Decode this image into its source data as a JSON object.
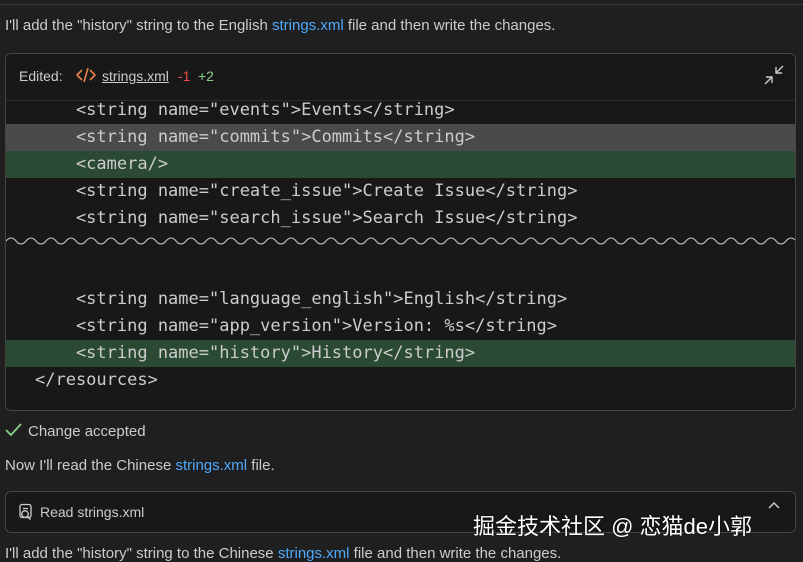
{
  "message_1": {
    "before": "I'll add the \"history\" string to the English ",
    "file": "strings.xml",
    "after": " file and then write the changes."
  },
  "edit_card": {
    "label": "Edited:",
    "file": "strings.xml",
    "removed": "-1",
    "added": "+2",
    "icon": "code-icon",
    "expand_icon": "expand-icon"
  },
  "code_lines": [
    {
      "text": "    <string name=\"events\">Events</string>",
      "kind": "context"
    },
    {
      "text": "    <string name=\"commits\">Commits</string>",
      "kind": "removed"
    },
    {
      "text": "    <camera/>",
      "kind": "added"
    },
    {
      "text": "    <string name=\"create_issue\">Create Issue</string>",
      "kind": "context"
    },
    {
      "text": "    <string name=\"search_issue\">Search Issue</string>",
      "kind": "context"
    },
    {
      "text": "    <string name=\"language_english\">English</string>",
      "kind": "context"
    },
    {
      "text": "    <string name=\"app_version\">Version: %s</string>",
      "kind": "context"
    },
    {
      "text": "    <string name=\"history\">History</string>",
      "kind": "added"
    },
    {
      "text": "</resources>",
      "kind": "context"
    }
  ],
  "change_status": {
    "text": "Change accepted",
    "icon": "check-icon"
  },
  "message_2": {
    "before": "Now I'll read the Chinese ",
    "file": "strings.xml",
    "after": " file."
  },
  "read_card": {
    "label": "Read strings.xml",
    "icon": "read-file-icon",
    "collapse_icon": "chevron-up-icon"
  },
  "message_3": {
    "before": "I'll add the \"history\" string to the Chinese ",
    "file": "strings.xml",
    "after": " file and then write the changes."
  },
  "watermark": "掘金技术社区 @ 恋猫de小郭",
  "colors": {
    "background": "#1f1f1f",
    "card": "#181818",
    "link": "#4daafc",
    "removed_line": "#4a4a4a",
    "added_line": "#2b4a34",
    "removed_count": "#f14c4c",
    "added_count": "#89d185",
    "code_icon": "#e8834a"
  }
}
